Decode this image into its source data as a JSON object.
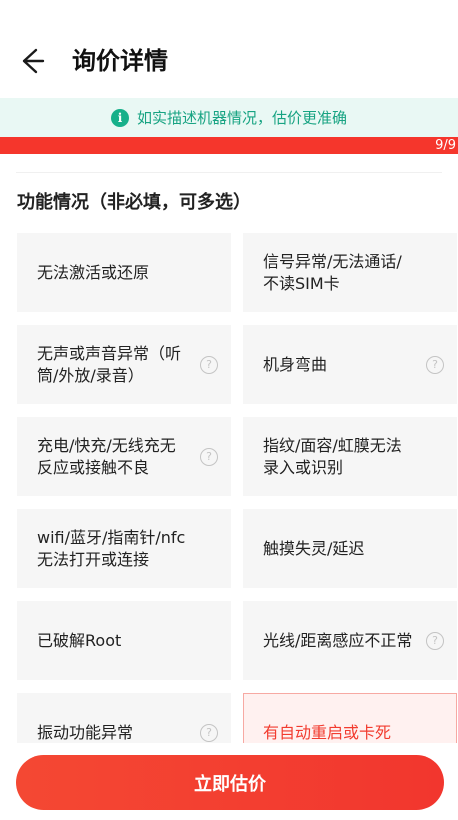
{
  "header": {
    "title": "询价详情"
  },
  "tip": {
    "text": "如实描述机器情况，估价更准确",
    "icon": "info-icon"
  },
  "progress": {
    "label": "9/9",
    "fraction": 1.0,
    "fill_color": "#f5362c"
  },
  "section": {
    "title": "功能情况（非必填，可多选）"
  },
  "options": [
    {
      "label": "无法激活或还原",
      "help": false,
      "selected": false
    },
    {
      "label": "信号异常/无法通话/不读SIM卡",
      "help": false,
      "selected": false
    },
    {
      "label": "无声或声音异常（听筒/外放/录音）",
      "help": true,
      "selected": false
    },
    {
      "label": "机身弯曲",
      "help": true,
      "selected": false
    },
    {
      "label": "充电/快充/无线充无反应或接触不良",
      "help": true,
      "selected": false
    },
    {
      "label": "指纹/面容/虹膜无法录入或识别",
      "help": false,
      "selected": false
    },
    {
      "label": "wifi/蓝牙/指南针/nfc无法打开或连接",
      "help": false,
      "selected": false
    },
    {
      "label": "触摸失灵/延迟",
      "help": false,
      "selected": false
    },
    {
      "label": "已破解Root",
      "help": false,
      "selected": false
    },
    {
      "label": "光线/距离感应不正常",
      "help": true,
      "selected": false
    },
    {
      "label": "振动功能异常",
      "help": true,
      "selected": false
    },
    {
      "label": "有自动重启或卡死",
      "help": false,
      "selected": true
    }
  ],
  "help_glyph": "?",
  "cta": {
    "label": "立即估价"
  },
  "colors": {
    "accent": "#f23c2f",
    "tip_green": "#17b08a",
    "card_bg": "#f6f6f6"
  }
}
